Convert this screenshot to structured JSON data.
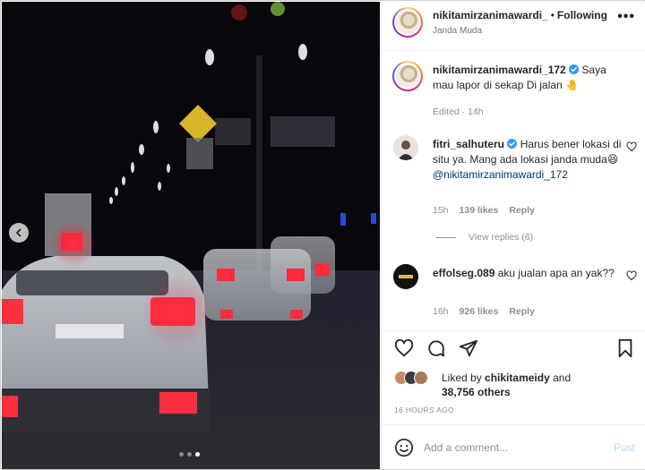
{
  "header": {
    "username": "nikitamirzanimawardi_",
    "separator": "•",
    "follow_label": "Following",
    "subtitle": "Janda Muda",
    "more_label": "•••"
  },
  "caption": {
    "username": "nikitamirzanimawardi_172",
    "text": "Saya mau lapor di sekap Di jalan",
    "emoji": "🤚",
    "meta": "Edited · 14h"
  },
  "comments": [
    {
      "username": "fitri_salhuteru",
      "text": "Harus bener lokasi di situ ya. Mang ada lokasi janda muda😆",
      "mention": "@nikitamirzanimawardi_172",
      "time": "15h",
      "likes": "139 likes",
      "reply_label": "Reply",
      "view_replies": "View replies (6)"
    },
    {
      "username": "effolseg.089",
      "text": "aku jualan apa an yak??",
      "time": "16h",
      "likes": "926 likes",
      "reply_label": "Reply"
    }
  ],
  "likes": {
    "prefix": "Liked by",
    "user": "chikitameidy",
    "and": "and",
    "others": "38,756 others"
  },
  "timestamp": "16 HOURS AGO",
  "add_comment": {
    "placeholder": "Add a comment...",
    "post_label": "Post"
  },
  "colors": {
    "verified": "#3897f0",
    "link": "#00376b",
    "post_disabled": "#b3dbff"
  },
  "icons": [
    "chevron-left-icon",
    "heart-icon",
    "comment-icon",
    "share-icon",
    "bookmark-icon",
    "emoji-icon",
    "verified-icon",
    "more-icon"
  ]
}
